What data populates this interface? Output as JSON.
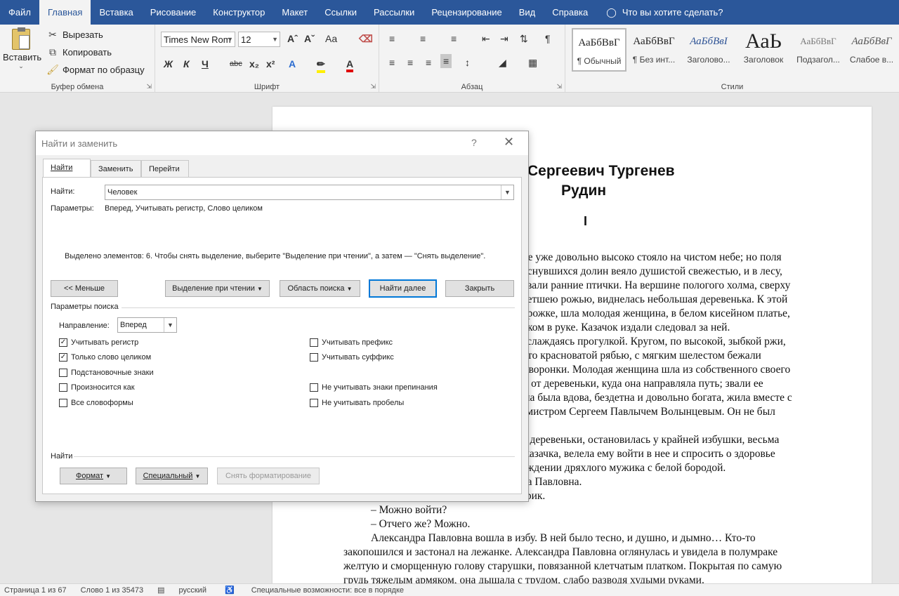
{
  "ribbon_tabs": [
    "Файл",
    "Главная",
    "Вставка",
    "Рисование",
    "Конструктор",
    "Макет",
    "Ссылки",
    "Рассылки",
    "Рецензирование",
    "Вид",
    "Справка"
  ],
  "tell_me": "Что вы хотите сделать?",
  "clipboard": {
    "paste": "Вставить",
    "cut": "Вырезать",
    "copy": "Копировать",
    "format_painter": "Формат по образцу",
    "label": "Буфер обмена"
  },
  "font": {
    "name": "Times New Rom",
    "size": "12",
    "label": "Шрифт"
  },
  "paragraph": {
    "label": "Абзац"
  },
  "styles": {
    "label": "Стили",
    "items": [
      {
        "sample": "АаБбВвГ",
        "name": "¶ Обычный"
      },
      {
        "sample": "АаБбВвГ",
        "name": "¶ Без инт..."
      },
      {
        "sample": "АаБбВвІ",
        "name": "Заголово..."
      },
      {
        "sample": "АаЬ",
        "name": "Заголовок"
      },
      {
        "sample": "АаБбВвГ",
        "name": "Подзагол..."
      },
      {
        "sample": "АаБбВвГ",
        "name": "Слабое в..."
      }
    ]
  },
  "document": {
    "author_partial": "Сергеевич Тургенев",
    "title": "Рудин",
    "chapter": "I",
    "lines": [
      "нце уже довольно высоко стояло на чистом небе; но поля",
      "роснувшихся долин веяло душистой свежестью, и в лесу,",
      "певали ранние птички. На вершине пологого холма, сверху",
      "цветшею рожью, виднелась небольшая деревенька. К этой",
      "дорожке, шла молодая женщина, в белом кисейном платье,",
      "ликом в руке. Казачок издали следовал за ней.",
      "наслаждаясь прогулкой. Кругом, по высокой, зыбкой ржи,",
      "й, то красноватой рябью, с мягким шелестом бежали",
      "жаворонки. Молодая женщина шла из собственного своего",
      "ты от деревеньки, куда она направляла путь; звали ее",
      "Она была вдова, бездетна и довольно богата, жила вместе с",
      "отмистром Сергеем Павлычем Волынцевым. Он не был",
      "",
      "до деревеньки, остановилась у крайней избушки, весьма",
      "о казачка, велела ему войти в нее и спросить о здоровье",
      "вождении дряхлого мужика с белой бородой.",
      "дра Павловна.",
      "тарик.",
      "– Можно войти?",
      "– Отчего же? Можно.",
      "Александра Павловна вошла в избу. В ней было тесно, и душно, и дымно… Кто-то",
      "закопошился и застонал на лежанке. Александра Павловна оглянулась и увидела в полумраке",
      "желтую и сморщенную голову старушки, повязанной клетчатым платком. Покрытая по самую",
      "грудь тяжелым армяком, она дышала с трудом, слабо разводя худыми руками."
    ]
  },
  "dialog": {
    "title": "Найти и заменить",
    "help": "?",
    "tabs": [
      "Найти",
      "Заменить",
      "Перейти"
    ],
    "find_label": "Найти:",
    "find_value": "Человек",
    "params_label": "Параметры:",
    "params_value": "Вперед, Учитывать регистр, Слово целиком",
    "message": "Выделено элементов: 6. Чтобы снять выделение, выберите \"Выделение при чтении\", а затем — \"Снять выделение\".",
    "buttons": {
      "less": "<< Меньше",
      "reading_highlight": "Выделение при чтении",
      "search_in": "Область поиска",
      "find_next": "Найти далее",
      "close": "Закрыть"
    },
    "search_options_label": "Параметры поиска",
    "direction_label": "Направление:",
    "direction_value": "Вперед",
    "options_left": [
      {
        "label": "Учитывать регистр",
        "checked": true
      },
      {
        "label": "Только слово целиком",
        "checked": true
      },
      {
        "label": "Подстановочные знаки",
        "checked": false
      },
      {
        "label": "Произносится как",
        "checked": false
      },
      {
        "label": "Все словоформы",
        "checked": false
      }
    ],
    "options_right": [
      {
        "label": "Учитывать префикс",
        "checked": false
      },
      {
        "label": "Учитывать суффикс",
        "checked": false
      },
      {
        "label": "Не учитывать знаки препинания",
        "checked": false
      },
      {
        "label": "Не учитывать пробелы",
        "checked": false
      }
    ],
    "find_section_label": "Найти",
    "format_btn": "Формат",
    "special_btn": "Специальный",
    "clear_format_btn": "Снять форматирование"
  },
  "status": {
    "page": "Страница 1 из 67",
    "words": "Слово 1 из 35473",
    "language": "русский",
    "accessibility": "Специальные возможности: все в порядке"
  },
  "colors": {
    "ribbon_blue": "#2b579a",
    "accent": "#0078d7"
  }
}
